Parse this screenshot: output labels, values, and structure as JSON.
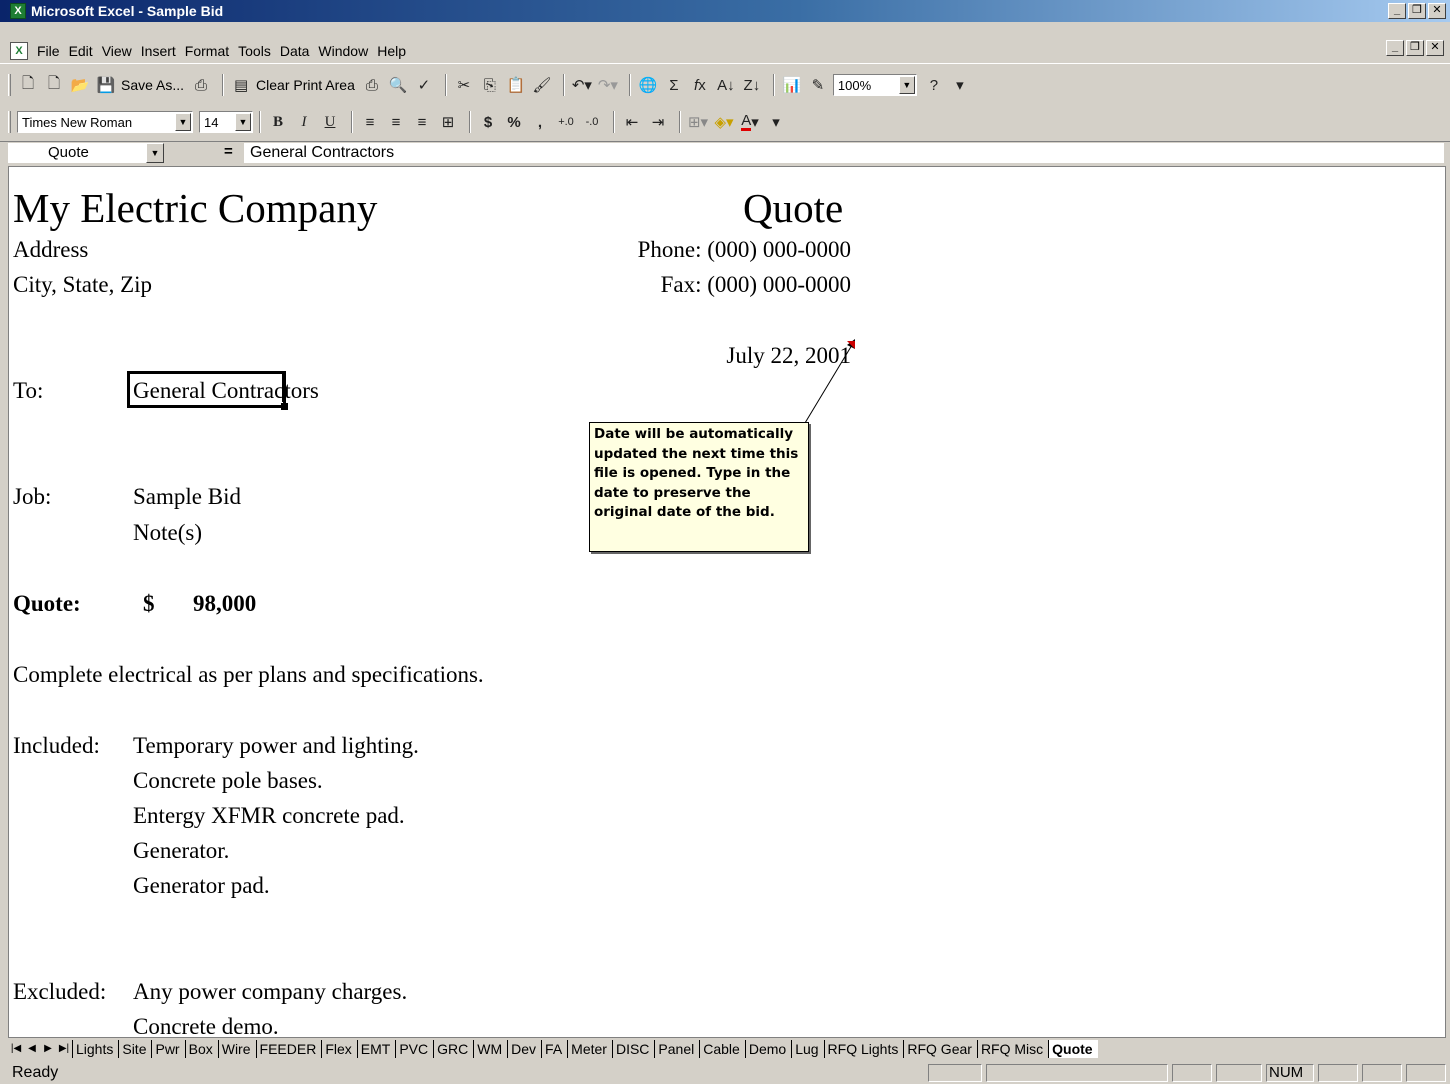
{
  "window": {
    "title": "Microsoft Excel - Sample Bid",
    "icon": "excel-icon"
  },
  "menubar": {
    "items": [
      "File",
      "Edit",
      "View",
      "Insert",
      "Format",
      "Tools",
      "Data",
      "Window",
      "Help"
    ]
  },
  "toolbar": {
    "save_as": "Save As...",
    "clear_print_area": "Clear Print Area",
    "zoom": "100%"
  },
  "format_toolbar": {
    "font": "Times New Roman",
    "size": "14"
  },
  "formula_bar": {
    "name_box": "Quote",
    "equals": "=",
    "content": "General Contractors"
  },
  "sheet": {
    "company": "My Electric Company",
    "heading": "Quote",
    "address": "Address",
    "city": "City, State, Zip",
    "phone": "Phone: (000) 000-0000",
    "fax": "Fax: (000) 000-0000",
    "date": "July 22, 2001",
    "to_label": "To:",
    "to_value": "General Contractors",
    "job_label": "Job:",
    "job_value": "Sample Bid",
    "notes": "Note(s)",
    "quote_label": "Quote:",
    "currency": "$",
    "quote_amount": "98,000",
    "scope": "Complete electrical as per plans and specifications.",
    "included_label": "Included:",
    "included": [
      "Temporary power and lighting.",
      "Concrete pole bases.",
      "Entergy XFMR concrete pad.",
      "Generator.",
      "Generator pad."
    ],
    "excluded_label": "Excluded:",
    "excluded": [
      "Any power company charges.",
      "Concrete demo."
    ],
    "comment": "Date will be automatically updated the next time this file is opened. Type in the date to preserve the original date of the bid."
  },
  "sheet_tabs": [
    "Lights",
    "Site",
    "Pwr",
    "Box",
    "Wire",
    "FEEDER",
    "Flex",
    "EMT",
    "PVC",
    "GRC",
    "WM",
    "Dev",
    "FA",
    "Meter",
    "DISC",
    "Panel",
    "Cable",
    "Demo",
    "Lug",
    "RFQ Lights",
    "RFQ Gear",
    "RFQ Misc",
    "Quote"
  ],
  "active_tab": "Quote",
  "status": {
    "text": "Ready",
    "num": "NUM"
  }
}
